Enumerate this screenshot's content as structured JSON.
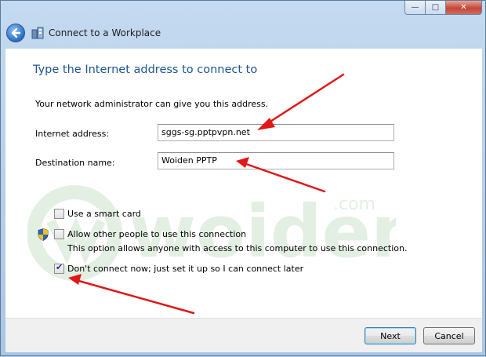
{
  "window": {
    "title": "Connect to a Workplace",
    "caption_buttons": {
      "minimize": "—",
      "maximize": "□",
      "close": "✕"
    }
  },
  "page": {
    "heading": "Type the Internet address to connect to",
    "description": "Your network administrator can give you this address."
  },
  "form": {
    "internet_address_label": "Internet address:",
    "internet_address_value": "sggs-sg.pptpvpn.net",
    "destination_label": "Destination name:",
    "destination_value": "Woiden PPTP"
  },
  "options": {
    "smart_card": {
      "label": "Use a smart card",
      "checked": false
    },
    "allow_others": {
      "label": "Allow other people to use this connection",
      "sublabel": "This option allows anyone with access to this computer to use this connection.",
      "checked": false
    },
    "dont_connect": {
      "label": "Don't connect now; just set it up so I can connect later",
      "checked": true
    }
  },
  "footer": {
    "next_label": "Next",
    "cancel_label": "Cancel"
  },
  "watermark": {
    "text": "woiden",
    "suffix": ".com"
  },
  "colors": {
    "heading": "#1d5490",
    "annotation_arrow": "#e01818",
    "watermark": "#2e8b2e"
  },
  "icons": [
    "back-arrow-icon",
    "network-icon",
    "uac-shield-icon",
    "checkmark-icon"
  ]
}
